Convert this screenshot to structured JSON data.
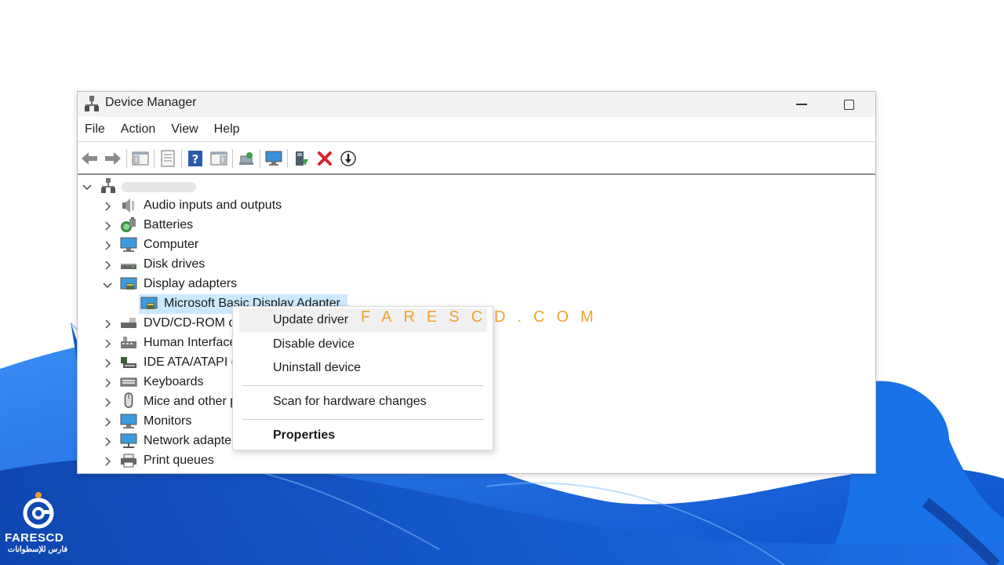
{
  "window": {
    "title": "Device Manager",
    "minimize_icon": "minimize-icon",
    "maximize_icon": "maximize-icon"
  },
  "menubar": {
    "items": [
      {
        "label": "File"
      },
      {
        "label": "Action"
      },
      {
        "label": "View"
      },
      {
        "label": "Help"
      }
    ]
  },
  "toolbar": {
    "buttons": [
      "back-icon",
      "forward-icon",
      "show-hide-console-tree-icon",
      "properties-icon",
      "help-icon",
      "action-pane-icon",
      "scan-hardware-icon",
      "monitor-icon",
      "update-driver-icon",
      "uninstall-icon",
      "disable-icon"
    ]
  },
  "tree": {
    "root_label": "",
    "nodes": [
      {
        "label": "Audio inputs and outputs",
        "icon": "speaker-icon",
        "expanded": false
      },
      {
        "label": "Batteries",
        "icon": "battery-icon",
        "expanded": false
      },
      {
        "label": "Computer",
        "icon": "computer-icon",
        "expanded": false
      },
      {
        "label": "Disk drives",
        "icon": "disk-drive-icon",
        "expanded": false
      },
      {
        "label": "Display adapters",
        "icon": "display-adapter-icon",
        "expanded": true
      },
      {
        "label": "Microsoft Basic Display Adapter",
        "icon": "display-adapter-icon",
        "child": true,
        "selected": true
      },
      {
        "label": "DVD/CD-ROM drives",
        "icon": "dvd-drive-icon",
        "expanded": false
      },
      {
        "label": "Human Interface Devices",
        "icon": "hid-icon",
        "expanded": false
      },
      {
        "label": "IDE ATA/ATAPI controllers",
        "icon": "ide-controller-icon",
        "expanded": false
      },
      {
        "label": "Keyboards",
        "icon": "keyboard-icon",
        "expanded": false
      },
      {
        "label": "Mice and other pointing devices",
        "icon": "mouse-icon",
        "expanded": false
      },
      {
        "label": "Monitors",
        "icon": "monitor-icon",
        "expanded": false
      },
      {
        "label": "Network adapters",
        "icon": "network-adapter-icon",
        "expanded": false
      },
      {
        "label": "Print queues",
        "icon": "printer-icon",
        "expanded": false
      }
    ]
  },
  "context_menu": {
    "update_driver": "Update driver",
    "disable_device": "Disable device",
    "uninstall_device": "Uninstall device",
    "scan_hardware": "Scan for hardware changes",
    "properties": "Properties"
  },
  "watermark": {
    "text": "FARESCD.COM"
  },
  "logo": {
    "name": "FARESCD",
    "subtitle": "فارس للإسطوانات"
  },
  "colors": {
    "selection": "#cce8ff",
    "wallpaper_blue": "#1a6fe0",
    "watermark": "#f0a030",
    "error_red": "#d9232d"
  }
}
